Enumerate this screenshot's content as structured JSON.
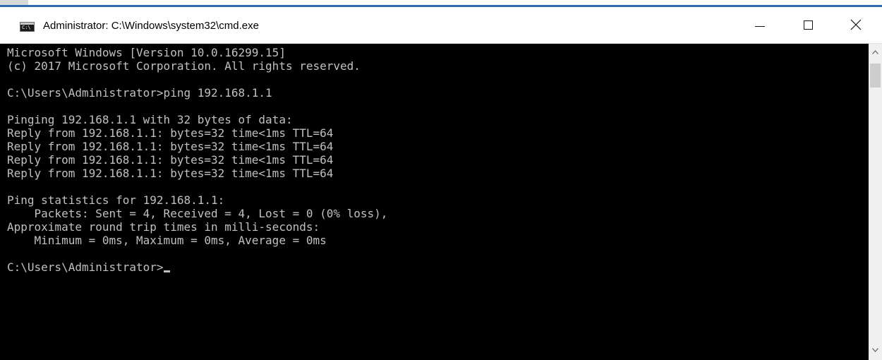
{
  "window": {
    "title": "Administrator: C:\\Windows\\system32\\cmd.exe",
    "app_icon": {
      "name": "cmd-icon",
      "text": "C:\\"
    },
    "controls": {
      "minimize_icon": "minimize-icon",
      "maximize_icon": "maximize-icon",
      "close_icon": "close-icon"
    }
  },
  "console": {
    "lines": [
      "Microsoft Windows [Version 10.0.16299.15]",
      "(c) 2017 Microsoft Corporation. All rights reserved.",
      "",
      "C:\\Users\\Administrator>ping 192.168.1.1",
      "",
      "Pinging 192.168.1.1 with 32 bytes of data:",
      "Reply from 192.168.1.1: bytes=32 time<1ms TTL=64",
      "Reply from 192.168.1.1: bytes=32 time<1ms TTL=64",
      "Reply from 192.168.1.1: bytes=32 time<1ms TTL=64",
      "Reply from 192.168.1.1: bytes=32 time<1ms TTL=64",
      "",
      "Ping statistics for 192.168.1.1:",
      "    Packets: Sent = 4, Received = 4, Lost = 0 (0% loss),",
      "Approximate round trip times in milli-seconds:",
      "    Minimum = 0ms, Maximum = 0ms, Average = 0ms",
      "",
      "C:\\Users\\Administrator>"
    ]
  },
  "colors": {
    "console_background": "#000000",
    "console_text": "#c0c0c0",
    "titlebar_background": "#ffffff",
    "window_accent": "#2b6cb0"
  },
  "scrollbar": {
    "up_icon": "scroll-up-arrow-icon",
    "down_icon": "scroll-down-arrow-icon"
  }
}
